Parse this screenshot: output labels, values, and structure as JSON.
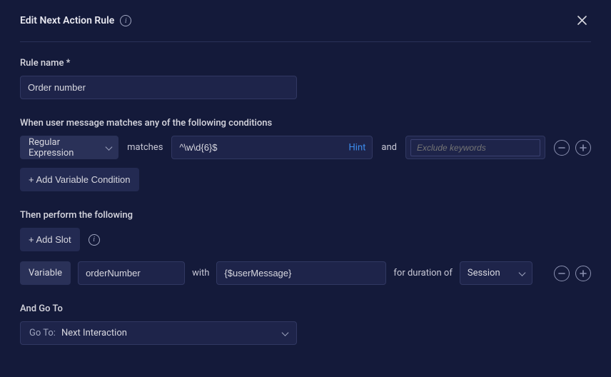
{
  "header": {
    "title": "Edit Next Action Rule"
  },
  "ruleName": {
    "label": "Rule name *",
    "value": "Order number"
  },
  "conditions": {
    "label": "When user message matches any of the following conditions",
    "typeLabel": "Regular Expression",
    "matchesText": "matches",
    "patternValue": "^\\w\\d{6}$",
    "hintText": "Hint",
    "andText": "and",
    "excludePlaceholder": "Exclude keywords",
    "addVariableConditionLabel": "+ Add Variable Condition"
  },
  "actions": {
    "label": "Then perform the following",
    "addSlotLabel": "+ Add Slot",
    "variableChipLabel": "Variable",
    "variableName": "orderNumber",
    "withText": "with",
    "valueText": "{$userMessage}",
    "durationText": "for duration of",
    "durationValue": "Session"
  },
  "goto": {
    "label": "And Go To",
    "prefix": "Go To:",
    "value": "Next Interaction"
  }
}
